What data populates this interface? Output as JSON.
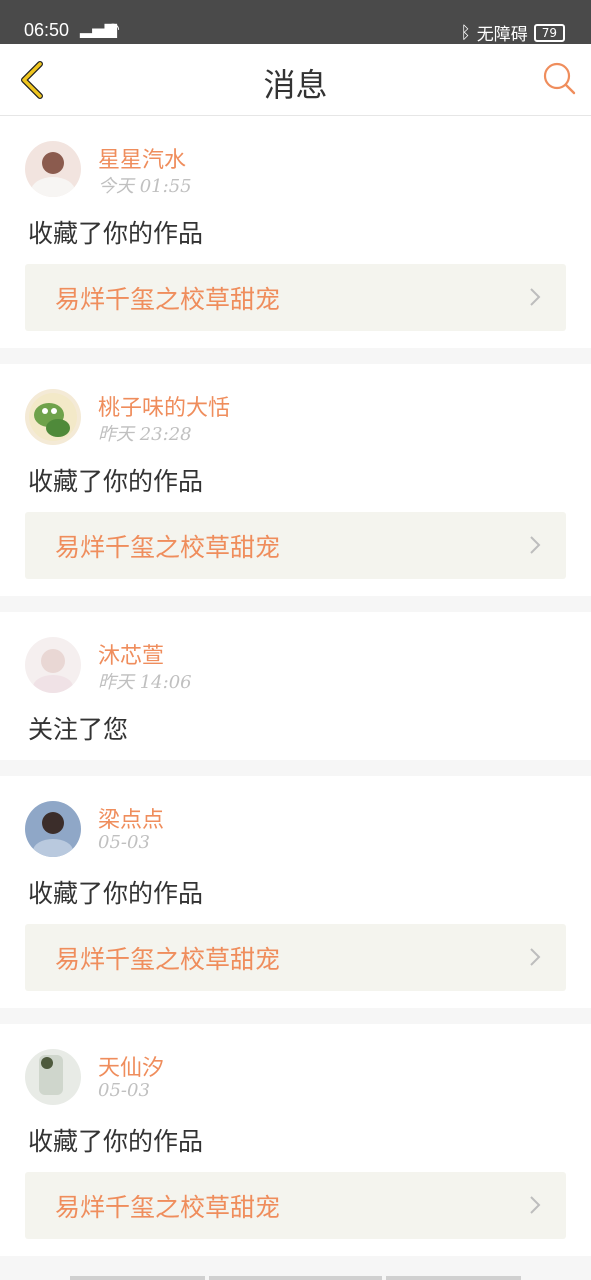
{
  "status": {
    "time": "06:50",
    "signal": "4G",
    "accessibility": "无障碍",
    "battery": "79"
  },
  "header": {
    "title": "消息",
    "back_icon": "chevron-left-icon",
    "search_icon": "search-icon"
  },
  "messages": [
    {
      "name": "星星汽水",
      "time": "今天 01:55",
      "action": "收藏了你的作品",
      "work": "易烊千玺之校草甜宠"
    },
    {
      "name": "桃子味的大恬",
      "time": "昨天 23:28",
      "action": "收藏了你的作品",
      "work": "易烊千玺之校草甜宠"
    },
    {
      "name": "沐芯萱",
      "time": "昨天 14:06",
      "action": "关注了您"
    },
    {
      "name": "梁点点",
      "time": "05-03",
      "action": "收藏了你的作品",
      "work": "易烊千玺之校草甜宠"
    },
    {
      "name": "天仙汐",
      "time": "05-03",
      "action": "收藏了你的作品",
      "work": "易烊千玺之校草甜宠"
    }
  ],
  "colors": {
    "accent": "#ef8d5c",
    "back": "#f0c61f",
    "text": "#333333",
    "muted": "#c0c0c0"
  }
}
